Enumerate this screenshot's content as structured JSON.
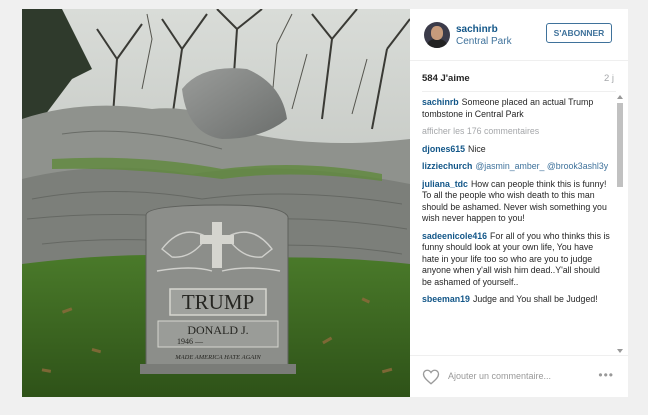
{
  "post": {
    "username": "sachinrb",
    "location": "Central Park",
    "follow_label": "S'ABONNER",
    "likes": "584 J'aime",
    "age": "2 j",
    "caption": "Someone placed an actual Trump tombstone in Central Park",
    "show_all": "afficher les 176 commentaires",
    "comment_placeholder": "Ajouter un commentaire...",
    "more_label": "•••"
  },
  "tombstone": {
    "name": "TRUMP",
    "first": "DONALD J.",
    "year": "1946 —",
    "epitaph": "MADE AMERICA HATE AGAIN"
  },
  "comments": [
    {
      "user": "djones615",
      "text": "Nice"
    },
    {
      "user": "lizziechurch",
      "mention": "@jasmin_amber_ @brook3ashl3y",
      "text": ""
    },
    {
      "user": "juliana_tdc",
      "text": "How can people think this is funny! To all the people who wish death to this man should be ashamed. Never wish something you wish never happen to you!"
    },
    {
      "user": "sadeenicole416",
      "text": "For all of you who thinks this is funny should look at your own life, You have hate in your life too so who are you to judge anyone when y'all wish him dead..Y'all should be ashamed of yourself.."
    },
    {
      "user": "sbeeman19",
      "text": "Judge and You shall be Judged!"
    }
  ],
  "colors": {
    "link": "#125688",
    "accent": "#3f729b",
    "muted": "#a5a7aa"
  },
  "icons": {
    "like": "heart-icon",
    "options": "more-options-icon"
  }
}
